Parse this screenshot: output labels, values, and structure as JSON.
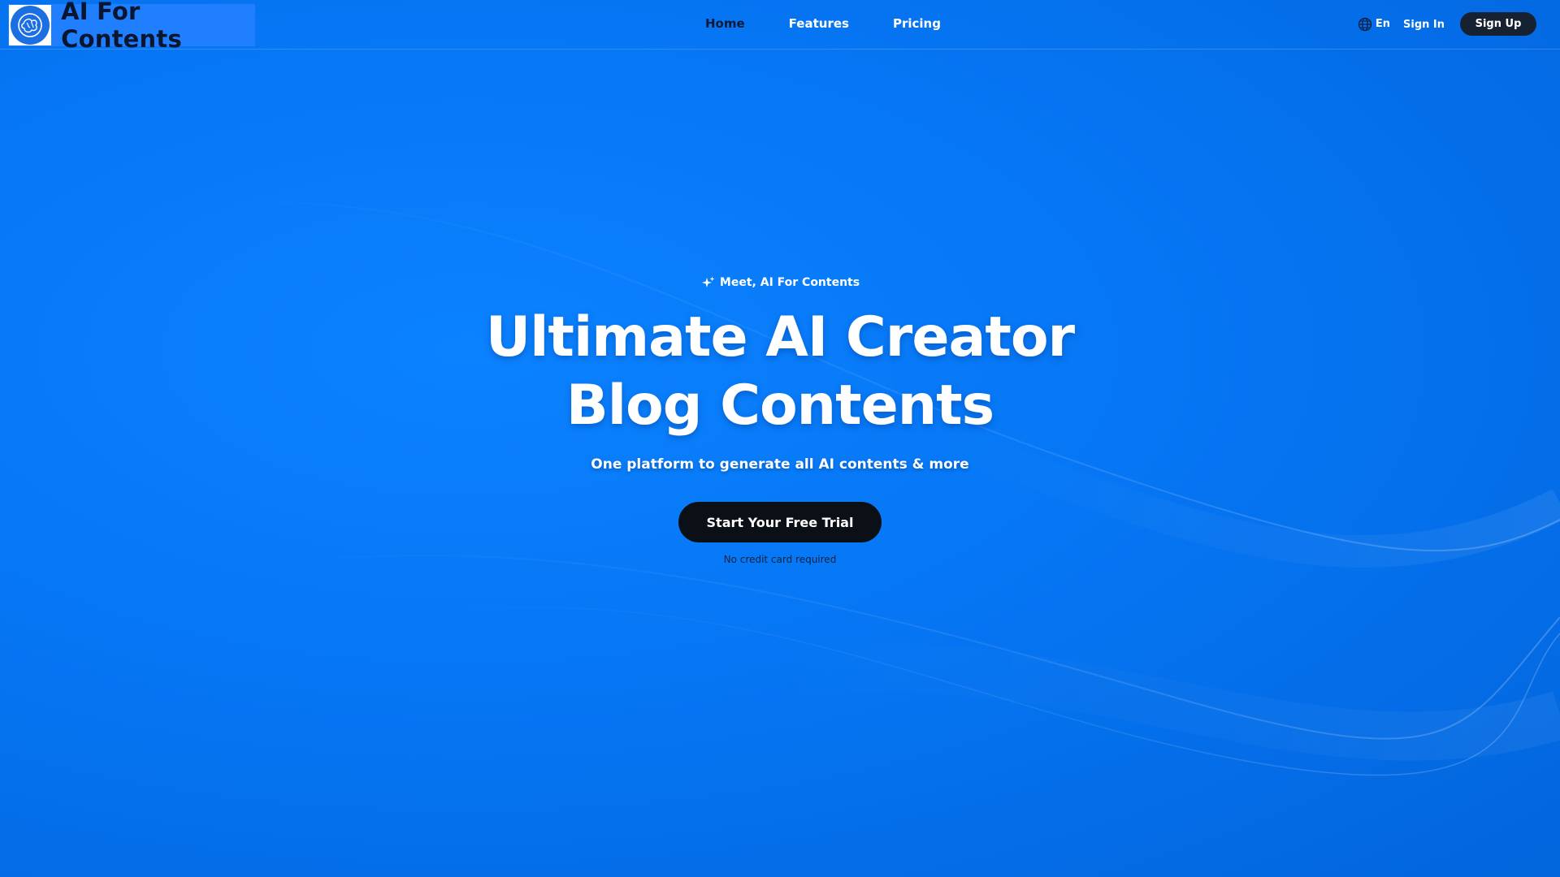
{
  "header": {
    "logo_text": "AI For Contents",
    "nav": [
      {
        "label": "Home",
        "active": true
      },
      {
        "label": "Features",
        "active": false
      },
      {
        "label": "Pricing",
        "active": false
      }
    ],
    "language": "En",
    "sign_in": "Sign In",
    "sign_up": "Sign Up"
  },
  "hero": {
    "eyebrow": "Meet, AI For Contents",
    "headline_line1": "Ultimate AI Creator",
    "headline_line2": "Blog Contents",
    "subline": "One platform to generate all AI contents & more",
    "cta": "Start Your Free Trial",
    "note": "No credit card required"
  },
  "colors": {
    "background": "#0676f4",
    "dark_button": "#0b0f16",
    "signup_button": "#162232",
    "active_nav": "#0d1b3a"
  },
  "icons": {
    "logo": "brain-icon",
    "language": "globe-icon",
    "eyebrow": "sparkles-icon"
  }
}
